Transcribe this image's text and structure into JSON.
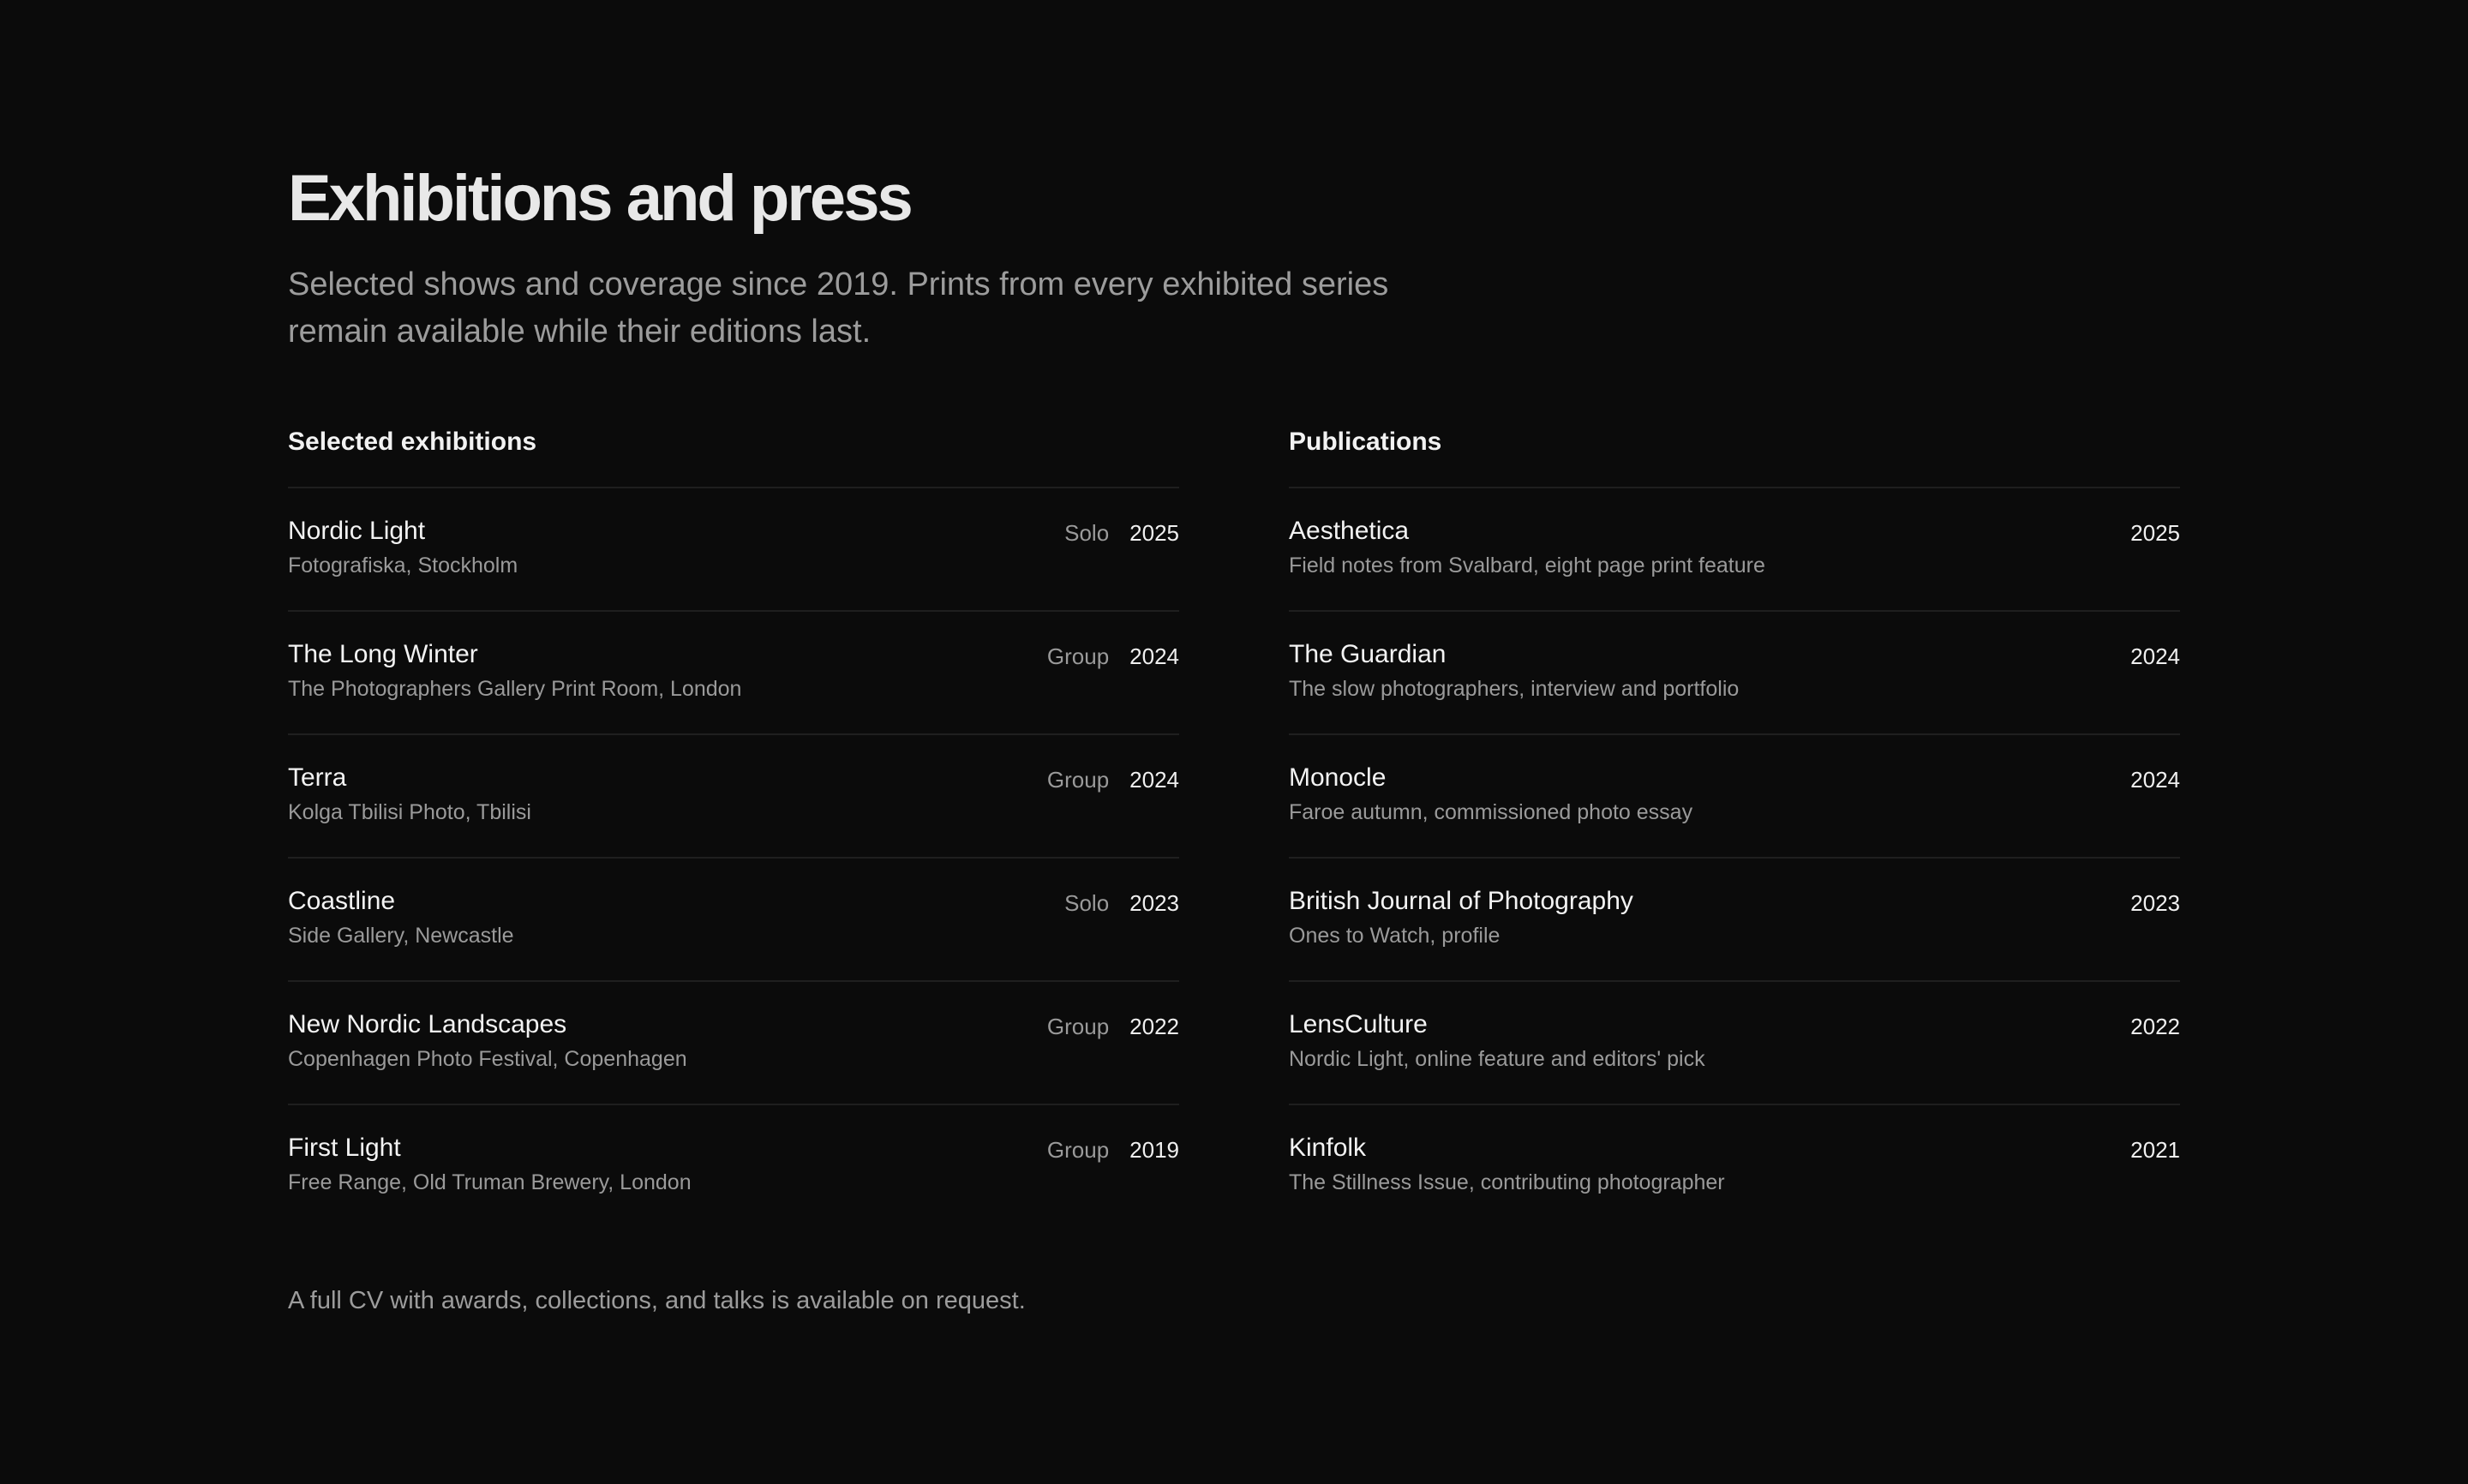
{
  "header": {
    "title": "Exhibitions and press",
    "intro": "Selected shows and coverage since 2019. Prints from every exhibited series remain available while their editions last."
  },
  "exhibitions": {
    "heading": "Selected exhibitions",
    "items": [
      {
        "title": "Nordic Light",
        "venue": "Fotografiska, Stockholm",
        "type": "Solo",
        "year": "2025"
      },
      {
        "title": "The Long Winter",
        "venue": "The Photographers Gallery Print Room, London",
        "type": "Group",
        "year": "2024"
      },
      {
        "title": "Terra",
        "venue": "Kolga Tbilisi Photo, Tbilisi",
        "type": "Group",
        "year": "2024"
      },
      {
        "title": "Coastline",
        "venue": "Side Gallery, Newcastle",
        "type": "Solo",
        "year": "2023"
      },
      {
        "title": "New Nordic Landscapes",
        "venue": "Copenhagen Photo Festival, Copenhagen",
        "type": "Group",
        "year": "2022"
      },
      {
        "title": "First Light",
        "venue": "Free Range, Old Truman Brewery, London",
        "type": "Group",
        "year": "2019"
      }
    ]
  },
  "publications": {
    "heading": "Publications",
    "items": [
      {
        "title": "Aesthetica",
        "description": "Field notes from Svalbard, eight page print feature",
        "year": "2025"
      },
      {
        "title": "The Guardian",
        "description": "The slow photographers, interview and portfolio",
        "year": "2024"
      },
      {
        "title": "Monocle",
        "description": "Faroe autumn, commissioned photo essay",
        "year": "2024"
      },
      {
        "title": "British Journal of Photography",
        "description": "Ones to Watch, profile",
        "year": "2023"
      },
      {
        "title": "LensCulture",
        "description": "Nordic Light, online feature and editors' pick",
        "year": "2022"
      },
      {
        "title": "Kinfolk",
        "description": "The Stillness Issue, contributing photographer",
        "year": "2021"
      }
    ]
  },
  "footer": {
    "note": "A full CV with awards, collections, and talks is available on request."
  },
  "colors": {
    "background": "#0b0b0b",
    "primary_text": "#f0f0f0",
    "secondary_text": "#9a9a9a",
    "divider": "#1f1f1f"
  }
}
